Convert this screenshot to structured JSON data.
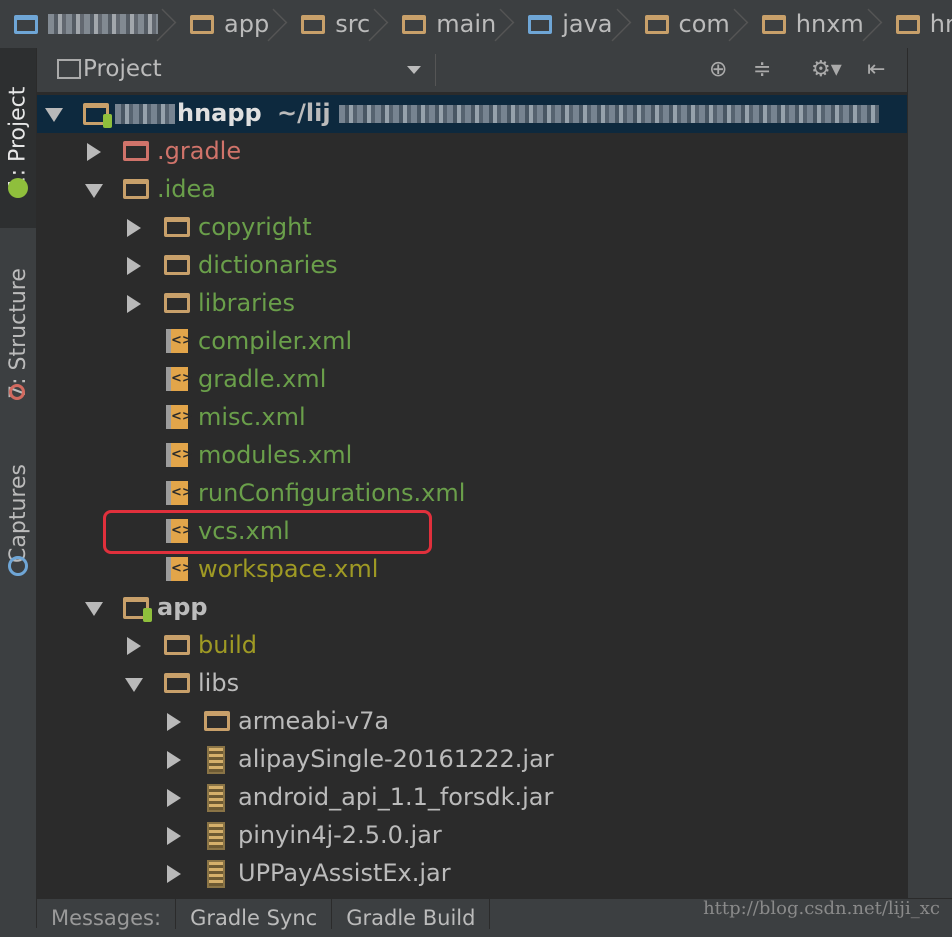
{
  "breadcrumb": [
    "app",
    "src",
    "main",
    "java",
    "com",
    "hnxm",
    "hnapp"
  ],
  "tool_strip": {
    "project_tab": "1: Project",
    "structure_tab": "7: Structure",
    "captures_tab": "Captures"
  },
  "project_panel": {
    "title": "Project",
    "root_label": "hnapp",
    "root_path": "~/lij"
  },
  "tree": [
    {
      "label": ".gradle",
      "icon": "folder",
      "level": 1,
      "expander": "collapsed",
      "color": "red"
    },
    {
      "label": ".idea",
      "icon": "folder",
      "level": 1,
      "expander": "expanded",
      "color": "green"
    },
    {
      "label": "copyright",
      "icon": "folder",
      "level": 2,
      "expander": "collapsed",
      "color": "green"
    },
    {
      "label": "dictionaries",
      "icon": "folder",
      "level": 2,
      "expander": "collapsed",
      "color": "green"
    },
    {
      "label": "libraries",
      "icon": "folder",
      "level": 2,
      "expander": "collapsed",
      "color": "green"
    },
    {
      "label": "compiler.xml",
      "icon": "xml-file",
      "level": 2,
      "expander": "none",
      "color": "green"
    },
    {
      "label": "gradle.xml",
      "icon": "xml-file",
      "level": 2,
      "expander": "none",
      "color": "green"
    },
    {
      "label": "misc.xml",
      "icon": "xml-file",
      "level": 2,
      "expander": "none",
      "color": "green"
    },
    {
      "label": "modules.xml",
      "icon": "xml-file",
      "level": 2,
      "expander": "none",
      "color": "green"
    },
    {
      "label": "runConfigurations.xml",
      "icon": "xml-file",
      "level": 2,
      "expander": "none",
      "color": "green"
    },
    {
      "label": "vcs.xml",
      "icon": "xml-file",
      "level": 2,
      "expander": "none",
      "color": "green",
      "highlighted": true
    },
    {
      "label": "workspace.xml",
      "icon": "xml-file",
      "level": 2,
      "expander": "none",
      "color": "olive"
    },
    {
      "label": "app",
      "icon": "module",
      "level": 1,
      "expander": "expanded",
      "color": "default"
    },
    {
      "label": "build",
      "icon": "folder",
      "level": 2,
      "expander": "collapsed",
      "color": "olive"
    },
    {
      "label": "libs",
      "icon": "folder",
      "level": 2,
      "expander": "expanded",
      "color": "default"
    },
    {
      "label": "armeabi-v7a",
      "icon": "folder",
      "level": 3,
      "expander": "collapsed",
      "color": "default"
    },
    {
      "label": "alipaySingle-20161222.jar",
      "icon": "jar",
      "level": 3,
      "expander": "collapsed",
      "color": "default"
    },
    {
      "label": "android_api_1.1_forsdk.jar",
      "icon": "jar",
      "level": 3,
      "expander": "collapsed",
      "color": "default"
    },
    {
      "label": "pinyin4j-2.5.0.jar",
      "icon": "jar",
      "level": 3,
      "expander": "collapsed",
      "color": "default"
    },
    {
      "label": "UPPayAssistEx.jar",
      "icon": "jar",
      "level": 3,
      "expander": "collapsed",
      "color": "default"
    }
  ],
  "bottom_tabs": [
    "Messages:",
    "Gradle Sync",
    "Gradle Build"
  ],
  "watermark": "http://blog.csdn.net/liji_xc",
  "colors": {
    "highlight_border": "#e0303c",
    "tree_bg": "#2b2b2b",
    "root_row_bg": "#0d293e"
  }
}
